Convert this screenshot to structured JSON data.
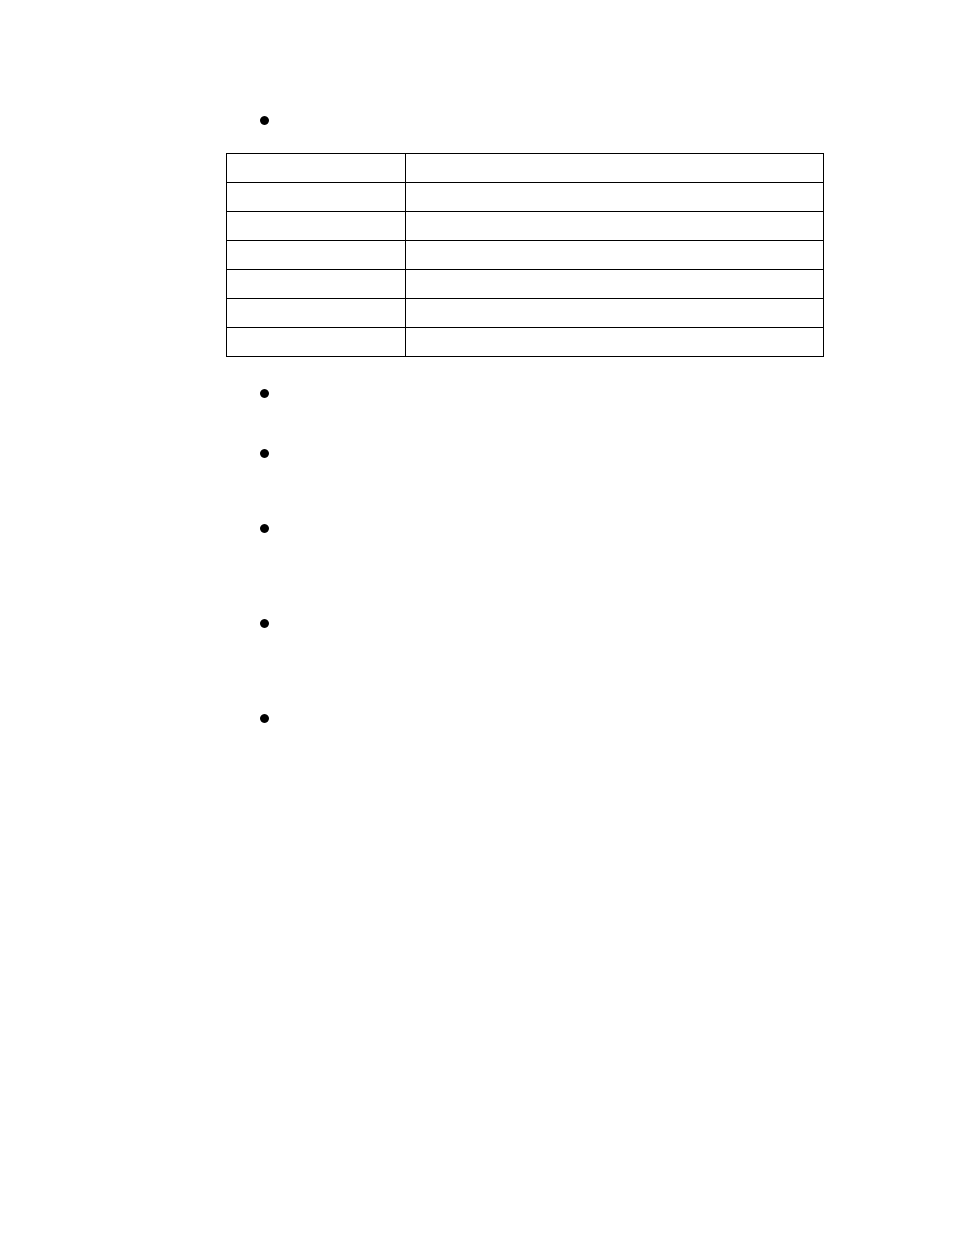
{
  "intro_bullet": "",
  "table": {
    "rows": [
      {
        "left": "",
        "right": ""
      },
      {
        "left": "",
        "right": ""
      },
      {
        "left": "",
        "right": ""
      },
      {
        "left": "",
        "right": ""
      },
      {
        "left": "",
        "right": ""
      },
      {
        "left": "",
        "right": ""
      },
      {
        "left": "",
        "right": ""
      }
    ]
  },
  "sub_bullets": [
    "",
    "",
    "",
    "",
    ""
  ]
}
